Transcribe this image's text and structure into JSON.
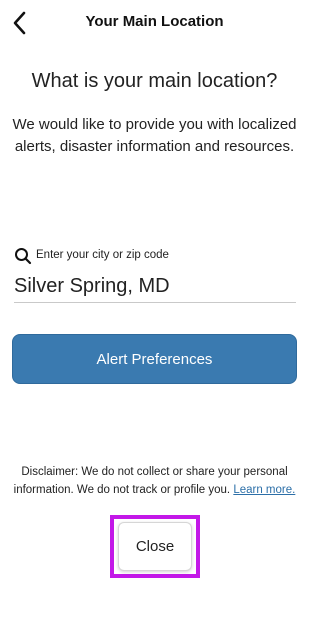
{
  "header": {
    "title": "Your Main Location",
    "back_icon": "chevron-left-icon"
  },
  "main": {
    "question": "What is your main location?",
    "description": "We would like to provide you with localized alerts, disaster information and resources.",
    "search": {
      "icon": "search-icon",
      "label": "Enter your city or zip code",
      "value": "Silver Spring, MD"
    },
    "alert_button_label": "Alert Preferences"
  },
  "footer": {
    "disclaimer": "Disclaimer: We do not collect or share your personal information. We do not track or profile you.",
    "learn_more": "Learn more.",
    "close_label": "Close"
  },
  "colors": {
    "accent": "#3a7ab0",
    "link": "#2c6fa8",
    "highlight": "#c318e8"
  }
}
